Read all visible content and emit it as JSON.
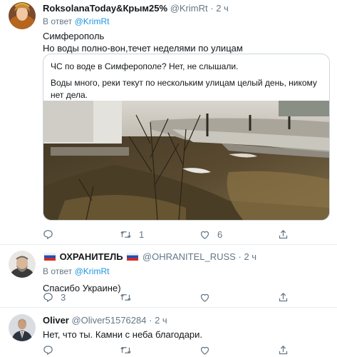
{
  "tweets": [
    {
      "name": "RoksolanaToday&Крым25%",
      "handle": "@KrimRt",
      "time": "2 ч",
      "reply_prefix": "В ответ",
      "reply_handle": "@KrimRt",
      "lines": [
        "Симферополь",
        "Но воды полно-вон,течет неделями по улицам"
      ],
      "quote": {
        "line1": "ЧС по воде в Симферополе? Нет, не слышали.",
        "line2": "Воды много, реки текут по нескольким улицам целый день, никому нет дела."
      },
      "retweets": "1",
      "likes": "6"
    },
    {
      "name": "ОХРАНИТЕЛЬ",
      "handle": "@OHRANITEL_RUSS",
      "time": "2 ч",
      "reply_prefix": "В ответ",
      "reply_handle": "@KrimRt",
      "text": "Спасибо Украине)",
      "replies": "3"
    },
    {
      "name": "Oliver",
      "handle": "@Oliver51576284",
      "time": "2 ч",
      "text": "Нет, что ты. Камни с неба благодари."
    }
  ],
  "separator": "·",
  "icons": [
    "reply-icon",
    "retweet-icon",
    "like-icon",
    "share-icon"
  ],
  "colors": {
    "link": "#1b95e0",
    "secondary": "#657786",
    "border": "#ccd6dd"
  }
}
